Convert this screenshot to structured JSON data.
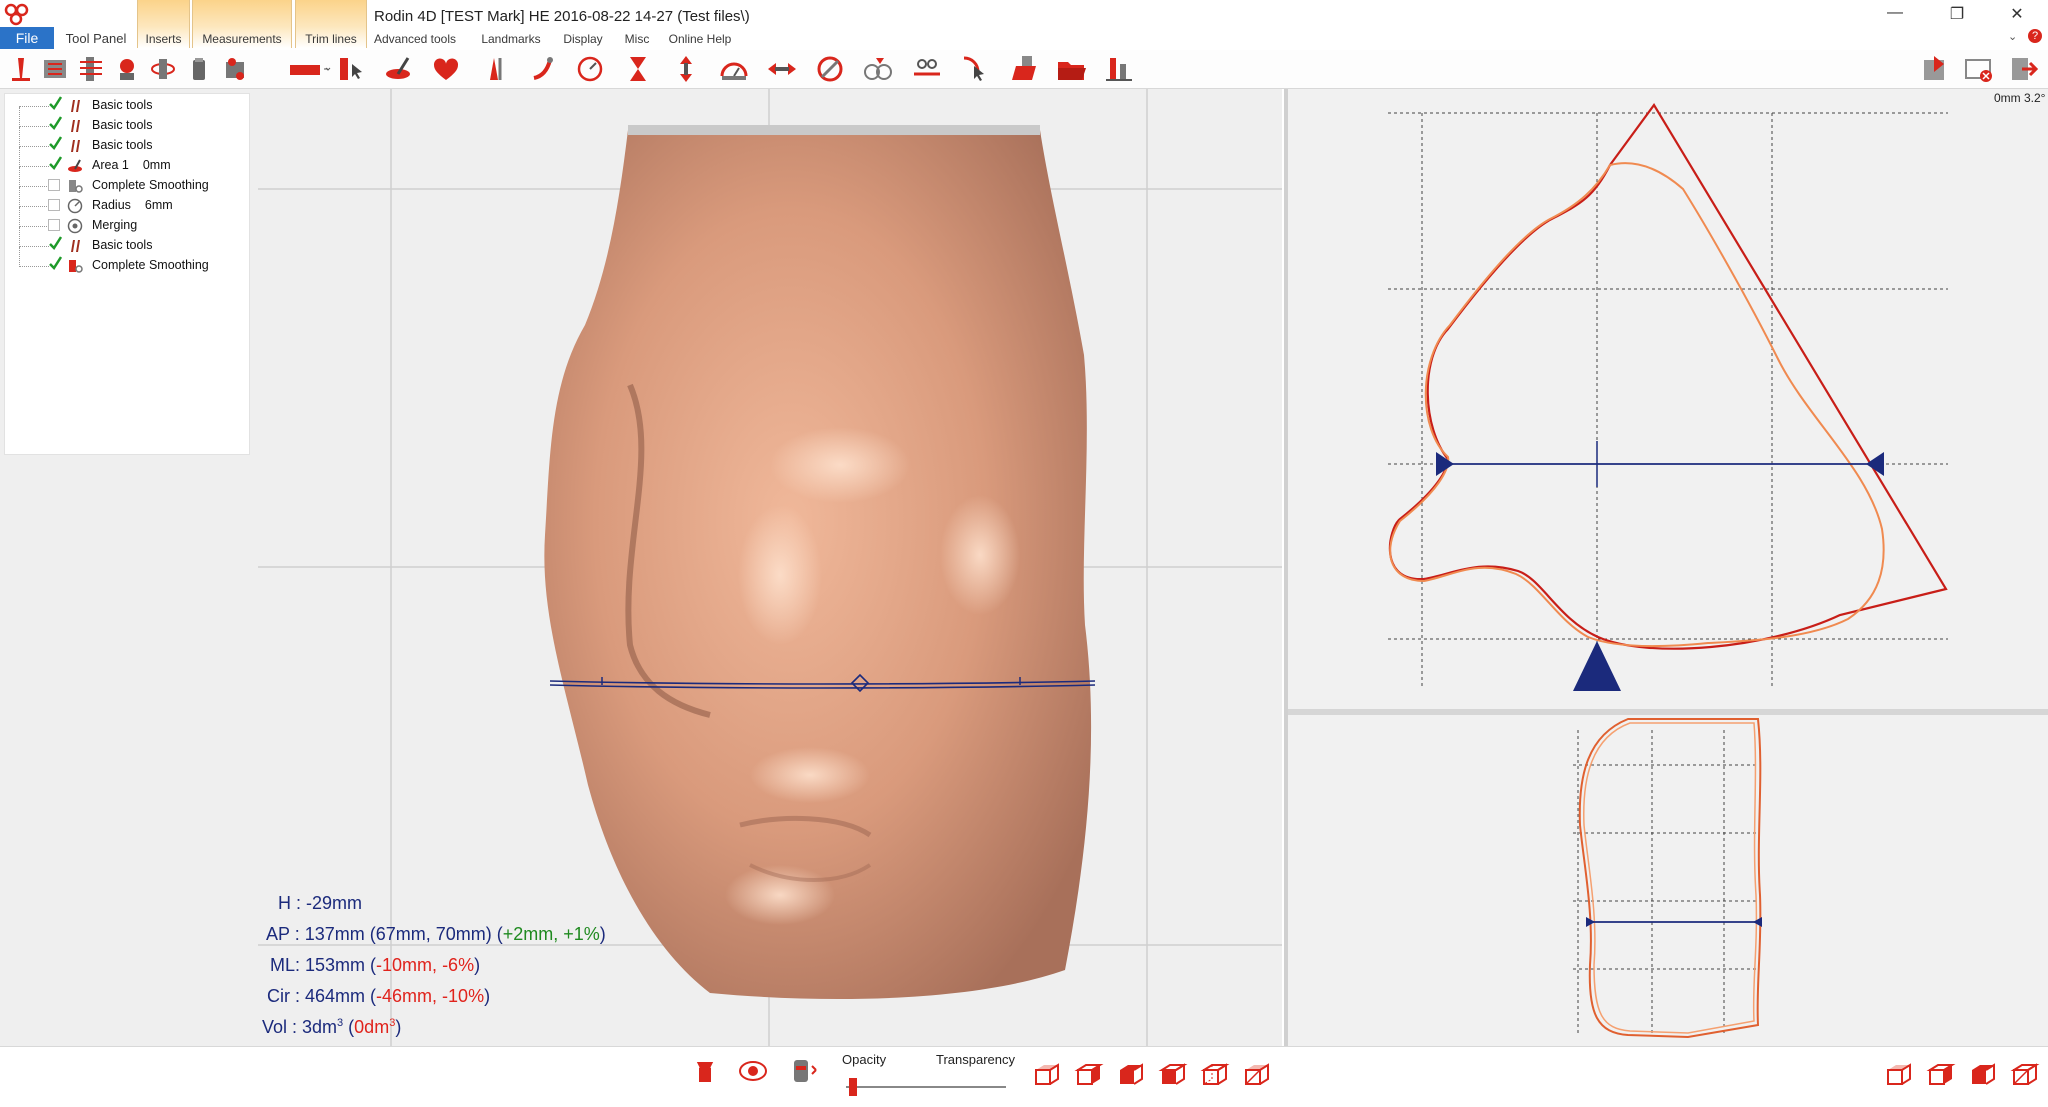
{
  "window": {
    "title": "Rodin 4D [TEST Mark] HE 2016-08-22  14-27 (Test files\\)",
    "controls": [
      "minimize",
      "restore",
      "close"
    ]
  },
  "ribbon": {
    "file_label": "File",
    "tabs": [
      {
        "label": "Tool Panel"
      },
      {
        "label": "Inserts"
      },
      {
        "label": "Measurements"
      },
      {
        "label": "Trim lines"
      },
      {
        "label": "Advanced tools"
      },
      {
        "label": "Landmarks"
      },
      {
        "label": "Display"
      },
      {
        "label": "Misc"
      },
      {
        "label": "Online Help"
      }
    ]
  },
  "tree": {
    "items": [
      {
        "label": "Basic tools",
        "checked": true,
        "icon": "basic-tools-icon"
      },
      {
        "label": "Basic tools",
        "checked": true,
        "icon": "basic-tools-icon"
      },
      {
        "label": "Basic tools",
        "checked": true,
        "icon": "basic-tools-icon"
      },
      {
        "label": "Area 1",
        "value": "0mm",
        "checked": true,
        "icon": "area-icon"
      },
      {
        "label": "Complete Smoothing",
        "checked": false,
        "icon": "smoothing-icon"
      },
      {
        "label": "Radius",
        "value": "6mm",
        "checked": false,
        "icon": "radius-icon"
      },
      {
        "label": "Merging",
        "checked": false,
        "icon": "merging-icon"
      },
      {
        "label": "Basic tools",
        "checked": true,
        "icon": "basic-tools-icon"
      },
      {
        "label": "Complete Smoothing",
        "checked": true,
        "icon": "smoothing-icon"
      }
    ]
  },
  "measurements": {
    "h": "H : -29mm",
    "ap_main": "AP : 137mm (67mm, 70mm) (",
    "ap_delta1": "+2mm",
    "ap_sep": ", ",
    "ap_delta2": "+1%",
    "ap_close": ")",
    "ml_main": "ML: 153mm (",
    "ml_delta1": "-10mm",
    "ml_sep": ", ",
    "ml_delta2": "-6%",
    "ml_close": ")",
    "cir_main": "Cir : 464mm (",
    "cir_delta1": "-46mm",
    "cir_sep": ", ",
    "cir_delta2": "-10%",
    "cir_close": ")",
    "vol_main": "Vol : 3dm",
    "vol_sup": "3",
    "vol_open": " (",
    "vol_delta": "0dm",
    "vol_delta_sup": "3",
    "vol_close": ")"
  },
  "section_view": {
    "zoom_readout": "0mm 3.2°"
  },
  "bottom": {
    "opacity_label": "Opacity",
    "transparency_label": "Transparency",
    "opacity_value": 0.02
  },
  "colors": {
    "accent": "#2b73c8",
    "brand_red": "#d9261c",
    "measure_blue": "#1b2a7c",
    "skin": "#d99a7c",
    "contour_orange": "#f08a50"
  }
}
